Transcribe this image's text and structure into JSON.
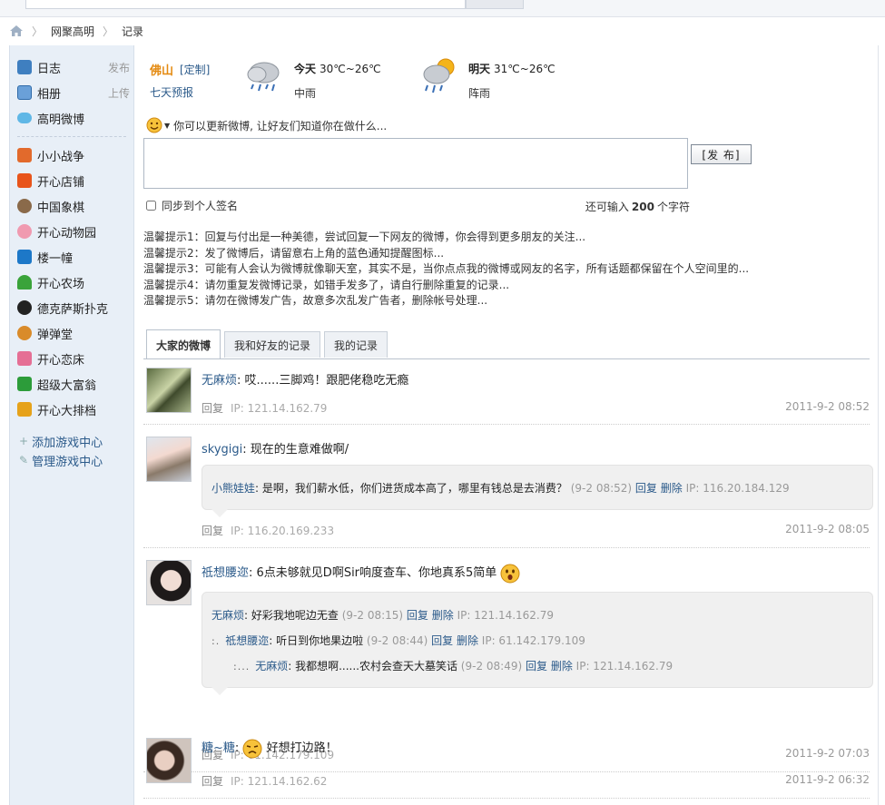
{
  "breadcrumb": {
    "site": "网聚高明",
    "current": "记录"
  },
  "sidebar": {
    "journal": {
      "label": "日志",
      "action": "发布"
    },
    "album": {
      "label": "相册",
      "action": "上传"
    },
    "weibo": {
      "label": "高明微博"
    },
    "games": [
      {
        "label": "小小战争",
        "color": "#e26a2c"
      },
      {
        "label": "开心店铺",
        "color": "#e8541b"
      },
      {
        "label": "中国象棋",
        "color": "#8a6a4a"
      },
      {
        "label": "开心动物园",
        "color": "#f09ab0"
      },
      {
        "label": "楼一幢",
        "color": "#1d78c8"
      },
      {
        "label": "开心农场",
        "color": "#3aa33a"
      },
      {
        "label": "德克萨斯扑克",
        "color": "#222222"
      },
      {
        "label": "弹弹堂",
        "color": "#d98b2a"
      },
      {
        "label": "开心恋床",
        "color": "#e56f95"
      },
      {
        "label": "超级大富翁",
        "color": "#2c9c3a"
      },
      {
        "label": "开心大排档",
        "color": "#e6a21a"
      }
    ],
    "add_game_center": "添加游戏中心",
    "manage_game_center": "管理游戏中心"
  },
  "weather": {
    "city": "佛山",
    "custom": "[定制]",
    "forecast": "七天预报",
    "today": {
      "label": "今天",
      "temp": "30℃~26℃",
      "desc": "中雨",
      "icon": "rain-cloud-icon"
    },
    "tomorrow": {
      "label": "明天",
      "temp": "31℃~26℃",
      "desc": "阵雨",
      "icon": "sun-shower-icon"
    }
  },
  "composer": {
    "prompt": "你可以更新微博, 让好友们知道你在做什么...",
    "value": "",
    "publish_label": "[发 布]",
    "sync_label": "同步到个人签名",
    "remain_prefix": "还可输入",
    "remain_count": "200",
    "remain_suffix": "个字符"
  },
  "tips": [
    "温馨提示1：回复与付出是一种美德，尝试回复一下网友的微博，你会得到更多朋友的关注...",
    "温馨提示2：发了微博后，请留意右上角的蓝色通知提醒图标...",
    "温馨提示3：可能有人会认为微博就像聊天室，其实不是，当你点点我的微博或网友的名字，所有话题都保留在个人空间里的...",
    "温馨提示4：请勿重复发微博记录，如错手发多了，请自行删除重复的记录...",
    "温馨提示5：请勿在微博发广告，故意多次乱发广告者，删除帐号处理..."
  ],
  "tabs": [
    "大家的微博",
    "我和好友的记录",
    "我的记录"
  ],
  "feed": [
    {
      "user": "无麻烦",
      "text": "哎......三脚鸡！跟肥佬稳吃无瘾",
      "reply": "回复",
      "ip": "IP: 121.14.162.79",
      "time": "2011-9-2 08:52"
    },
    {
      "user": "skygigi",
      "text": "现在的生意难做啊/",
      "reply": "回复",
      "ip": "IP: 116.20.169.233",
      "time": "2011-9-2 08:05",
      "replies": [
        {
          "user": "小熊娃娃",
          "text": "是啊，我们薪水低，你们进货成本高了，哪里有钱总是去消费？",
          "time": "(9-2 08:52)",
          "reply": "回复",
          "delete": "删除",
          "ip": "IP: 116.20.184.129"
        }
      ]
    },
    {
      "user": "祗想腰迩",
      "text": "6点未够就见D啊Sir响度查车、你地真系5简单",
      "reply": "回复",
      "ip": "IP: 61.142.179.109",
      "time": "2011-9-2 07:03",
      "replies": [
        {
          "user": "无麻烦",
          "text": "好彩我地呢边无查",
          "time": "(9-2 08:15)",
          "reply": "回复",
          "delete": "删除",
          "ip": "IP: 121.14.162.79"
        },
        {
          "user": "祗想腰迩",
          "text": "听日到你地果边啦",
          "time": "(9-2 08:44)",
          "reply": "回复",
          "delete": "删除",
          "ip": "IP: 61.142.179.109"
        },
        {
          "user": "无麻烦",
          "text": "我都想啊......农村会查天大墓笑话",
          "time": "(9-2 08:49)",
          "reply": "回复",
          "delete": "删除",
          "ip": "IP: 121.14.162.79"
        }
      ]
    },
    {
      "user": "糖~糖",
      "text": "好想打边路！",
      "reply": "回复",
      "ip": "IP: 121.14.162.62",
      "time": "2011-9-2 06:32"
    }
  ]
}
